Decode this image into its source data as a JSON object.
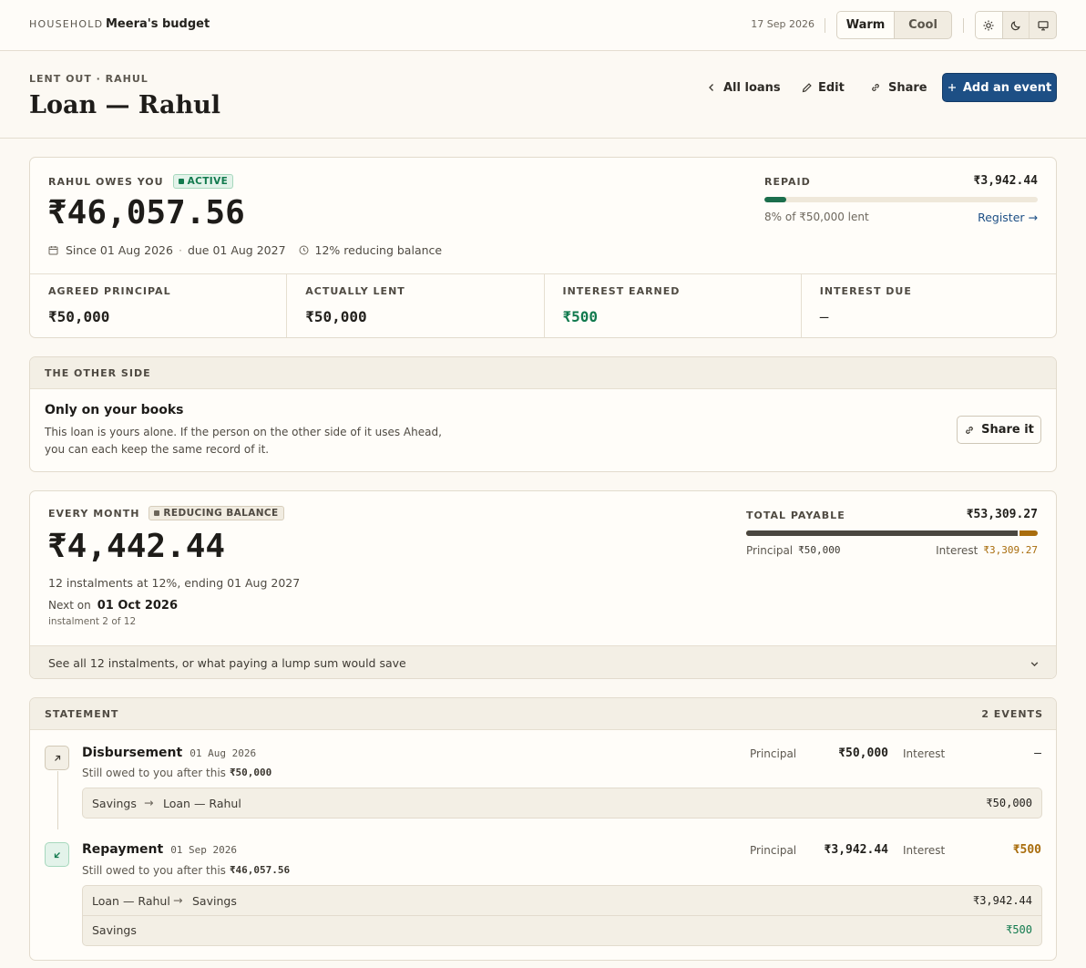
{
  "topbar": {
    "household_label": "HOUSEHOLD",
    "budget_name": "Meera's budget",
    "date": "17 Sep 2026",
    "theme_options": [
      "Warm",
      "Cool"
    ],
    "theme_selected": "Warm",
    "mode_icons": [
      "sun-icon",
      "moon-icon",
      "monitor-icon"
    ]
  },
  "header": {
    "eyebrow": "LENT OUT · RAHUL",
    "title": "Loan — Rahul",
    "all_loans": "All loans",
    "edit": "Edit",
    "share": "Share",
    "add_event": "Add an event"
  },
  "summary": {
    "owes_label": "RAHUL OWES YOU",
    "status": "ACTIVE",
    "amount": "₹46,057.56",
    "since": "Since 01 Aug 2026",
    "due": "due 01 Aug 2027",
    "rate": "12% reducing balance",
    "repaid_label": "REPAID",
    "repaid_amount": "₹3,942.44",
    "repaid_fraction": 0.08,
    "repaid_note": "8% of ₹50,000 lent",
    "register_link": "Register →",
    "stats": [
      {
        "label": "AGREED PRINCIPAL",
        "value": "₹50,000"
      },
      {
        "label": "ACTUALLY LENT",
        "value": "₹50,000"
      },
      {
        "label": "INTEREST EARNED",
        "value": "₹500"
      },
      {
        "label": "INTEREST DUE",
        "value": "—"
      }
    ]
  },
  "other_side": {
    "section_label": "THE OTHER SIDE",
    "heading": "Only on your books",
    "line1": "This loan is yours alone. If the person on the other side of it uses Ahead,",
    "line2": "you can each keep the same record of it.",
    "share_button": "Share it"
  },
  "schedule": {
    "label": "EVERY MONTH",
    "badge": "REDUCING BALANCE",
    "amount": "₹4,442.44",
    "summary": "12 instalments at 12%, ending 01 Aug 2027",
    "next_label": "Next on",
    "next_date": "01 Oct 2026",
    "instalment": "instalment 2 of 12",
    "total_label": "TOTAL PAYABLE",
    "total_amount": "₹53,309.27",
    "principal_label": "Principal",
    "principal_value": "₹50,000",
    "interest_label": "Interest",
    "interest_value": "₹3,309.27",
    "principal_fraction": 0.938,
    "expand_text": "See all 12 instalments, or what paying a lump sum would save"
  },
  "statement": {
    "label": "STATEMENT",
    "count": "2 EVENTS",
    "events": [
      {
        "type": "Disbursement",
        "date": "01 Aug 2026",
        "owed_prefix": "Still owed to you after this",
        "owed_value": "₹50,000",
        "principal_label": "Principal",
        "principal": "₹50,000",
        "interest_label": "Interest",
        "interest": "—",
        "legs": [
          {
            "from": "Savings",
            "arrow": "→",
            "to": "Loan — Rahul",
            "amount": "₹50,000"
          }
        ]
      },
      {
        "type": "Repayment",
        "date": "01 Sep 2026",
        "owed_prefix": "Still owed to you after this",
        "owed_value": "₹46,057.56",
        "principal_label": "Principal",
        "principal": "₹3,942.44",
        "interest_label": "Interest",
        "interest": "₹500",
        "legs": [
          {
            "from": "Loan — Rahul",
            "arrow": "→",
            "to": "Savings",
            "amount": "₹3,942.44"
          },
          {
            "from": "Savings",
            "arrow": "",
            "to": "",
            "amount": "₹500"
          }
        ]
      }
    ]
  },
  "colors": {
    "accent": "#1d4f85",
    "green": "#127a4e",
    "amber": "#a96d0d"
  }
}
